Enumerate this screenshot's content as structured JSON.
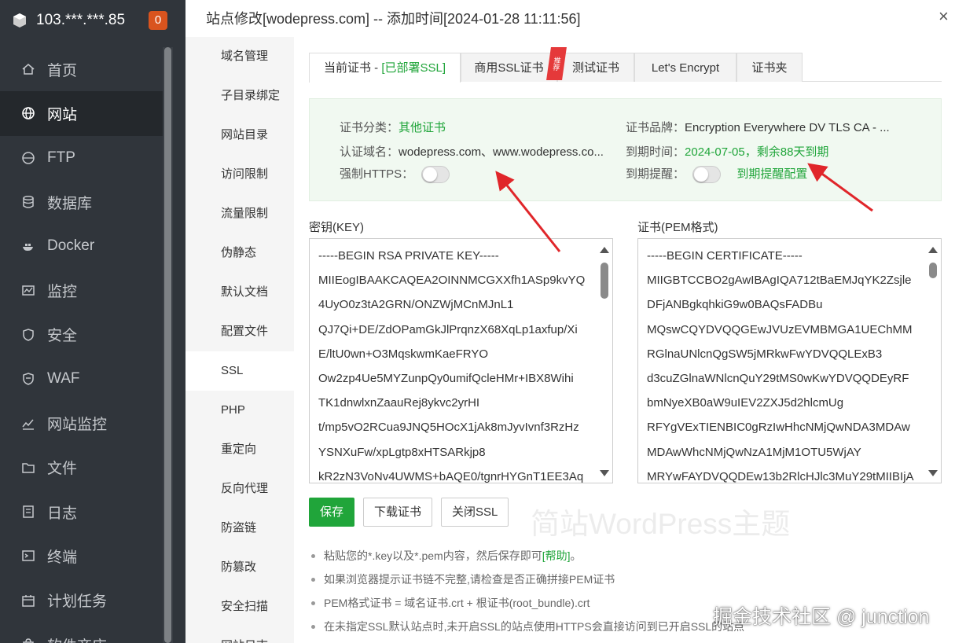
{
  "server": {
    "ip": "103.***.***.85",
    "badge": "0"
  },
  "app_nav": [
    {
      "label": "首页",
      "icon": "home-icon"
    },
    {
      "label": "网站",
      "icon": "globe-icon"
    },
    {
      "label": "FTP",
      "icon": "ftp-icon"
    },
    {
      "label": "数据库",
      "icon": "database-icon"
    },
    {
      "label": "Docker",
      "icon": "docker-icon"
    },
    {
      "label": "监控",
      "icon": "monitor-icon"
    },
    {
      "label": "安全",
      "icon": "shield-icon"
    },
    {
      "label": "WAF",
      "icon": "waf-icon"
    },
    {
      "label": "网站监控",
      "icon": "site-monitor-icon"
    },
    {
      "label": "文件",
      "icon": "folder-icon"
    },
    {
      "label": "日志",
      "icon": "log-icon"
    },
    {
      "label": "终端",
      "icon": "terminal-icon"
    },
    {
      "label": "计划任务",
      "icon": "calendar-icon"
    },
    {
      "label": "软件商店",
      "icon": "store-icon"
    }
  ],
  "modal": {
    "title": "站点修改[wodepress.com] -- 添加时间[2024-01-28 11:11:56]",
    "close": "×",
    "subnav": [
      "域名管理",
      "子目录绑定",
      "网站目录",
      "访问限制",
      "流量限制",
      "伪静态",
      "默认文档",
      "配置文件",
      "SSL",
      "PHP",
      "重定向",
      "反向代理",
      "防盗链",
      "防篡改",
      "安全扫描",
      "网站日志"
    ],
    "tabs": {
      "current_prefix": "当前证书 - ",
      "current_status": "[已部署SSL]",
      "commercial": "商用SSL证书",
      "ribbon": "推荐",
      "test": "测试证书",
      "letsencrypt": "Let's Encrypt",
      "folder": "证书夹"
    },
    "info": {
      "category_label": "证书分类：",
      "category_value": "其他证书",
      "brand_label": "证书品牌：",
      "brand_value": "Encryption Everywhere DV TLS CA - ...",
      "domains_label": "认证域名：",
      "domains_value": "wodepress.com、www.wodepress.co...",
      "expiry_label": "到期时间：",
      "expiry_value": "2024-07-05，剩余88天到期",
      "https_label": "强制HTTPS：",
      "remind_label": "到期提醒：",
      "remind_config": "到期提醒配置"
    },
    "key_label": "密钥(KEY)",
    "cert_label": "证书(PEM格式)",
    "key_lines": [
      "-----BEGIN RSA PRIVATE KEY-----",
      "MIIEogIBAAKCAQEA2OINNMCGXXfh1ASp9kvYQ",
      "4UyO0z3tA2GRN/ONZWjMCnMJnL1",
      "QJ7Qi+DE/ZdOPamGkJlPrqnzX68XqLp1axfup/Xi",
      "E/ltU0wn+O3MqskwmKaeFRYO",
      "Ow2zp4Ue5MYZunpQy0umifQcleHMr+IBX8Wihi",
      "TK1dnwlxnZaauRej8ykvc2yrHI",
      "t/mp5vO2RCua9JNQ5HOcX1jAk8mJyvIvnf3RzHz",
      "YSNXuFw/xpLgtp8xHTSARkjp8",
      "kR2zN3VoNv4UWMS+bAQE0/tgnrHYGnT1EE3Aq"
    ],
    "cert_lines": [
      "-----BEGIN CERTIFICATE-----",
      "MIIGBTCCBO2gAwIBAgIQA712tBaEMJqYK2Zsjle",
      "DFjANBgkqhkiG9w0BAQsFADBu",
      "MQswCQYDVQQGEwJVUzEVMBMGA1UEChMM",
      "RGlnaUNlcnQgSW5jMRkwFwYDVQQLExB3",
      "d3cuZGlnaWNlcnQuY29tMS0wKwYDVQQDEyRF",
      "bmNyeXB0aW9uIEV2ZXJ5d2hlcmUg",
      "RFYgVExTIENBIC0gRzIwHhcNMjQwNDA3MDAw",
      "MDAwWhcNMjQwNzA1MjM1OTU5WjAY",
      "MRYwFAYDVQQDEw13b2RlcHJlc3MuY29tMIIBIjA"
    ],
    "buttons": {
      "save": "保存",
      "download": "下载证书",
      "close_ssl": "关闭SSL"
    },
    "tips": {
      "tip1_text": "粘贴您的*.key以及*.pem内容，然后保存即可",
      "tip1_help": "[帮助]",
      "tip1_end": "。",
      "tip2": "如果浏览器提示证书链不完整,请检查是否正确拼接PEM证书",
      "tip3": "PEM格式证书 = 域名证书.crt + 根证书(root_bundle).crt",
      "tip4": "在未指定SSL默认站点时,未开启SSL的站点使用HTTPS会直接访问到已开启SSL的站点"
    }
  },
  "watermarks": {
    "center": "简站WordPress主题",
    "corner": "掘金技术社区 @ junction"
  },
  "colors": {
    "accent": "#20a53a",
    "sidebar": "#30353b",
    "badge": "#d9541e",
    "arrow": "#e0262a"
  }
}
